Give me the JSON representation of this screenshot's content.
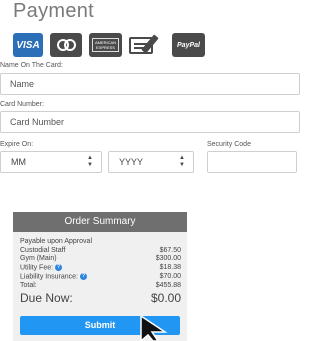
{
  "page": {
    "title": "Payment"
  },
  "card_icons": [
    {
      "name": "visa-icon",
      "text": "VISA"
    },
    {
      "name": "mastercard-icon"
    },
    {
      "name": "amex-icon",
      "text": "AMERICAN EXPRESS"
    },
    {
      "name": "generic-card-icon"
    },
    {
      "name": "paypal-icon",
      "text": "PayPal"
    }
  ],
  "form": {
    "name_label": "Name On The Card:",
    "name_placeholder": "Name",
    "card_label": "Card Number:",
    "card_placeholder": "Card Number",
    "expire_label": "Expire On:",
    "month_value": "MM",
    "year_value": "YYYY",
    "security_label": "Security Code",
    "security_value": ""
  },
  "summary": {
    "title": "Order Summary",
    "payable_note": "Payable upon Approval",
    "items": [
      {
        "label": "Custodial Staff",
        "amount": "$67.50",
        "info": false
      },
      {
        "label": "Gym (Main)",
        "amount": "$300.00",
        "info": false
      },
      {
        "label": "Utility Fee:",
        "amount": "$18.38",
        "info": true
      },
      {
        "label": "Liability Insurance:",
        "amount": "$70.00",
        "info": true
      },
      {
        "label": "Total:",
        "amount": "$455.88",
        "info": false
      }
    ],
    "due_label": "Due Now:",
    "due_amount": "$0.00",
    "submit_label": "Submit"
  },
  "colors": {
    "accent": "#2196f3",
    "visa": "#2a6fb8",
    "summary_header": "#6f6f6f",
    "summary_bg": "#f0f0f0"
  }
}
